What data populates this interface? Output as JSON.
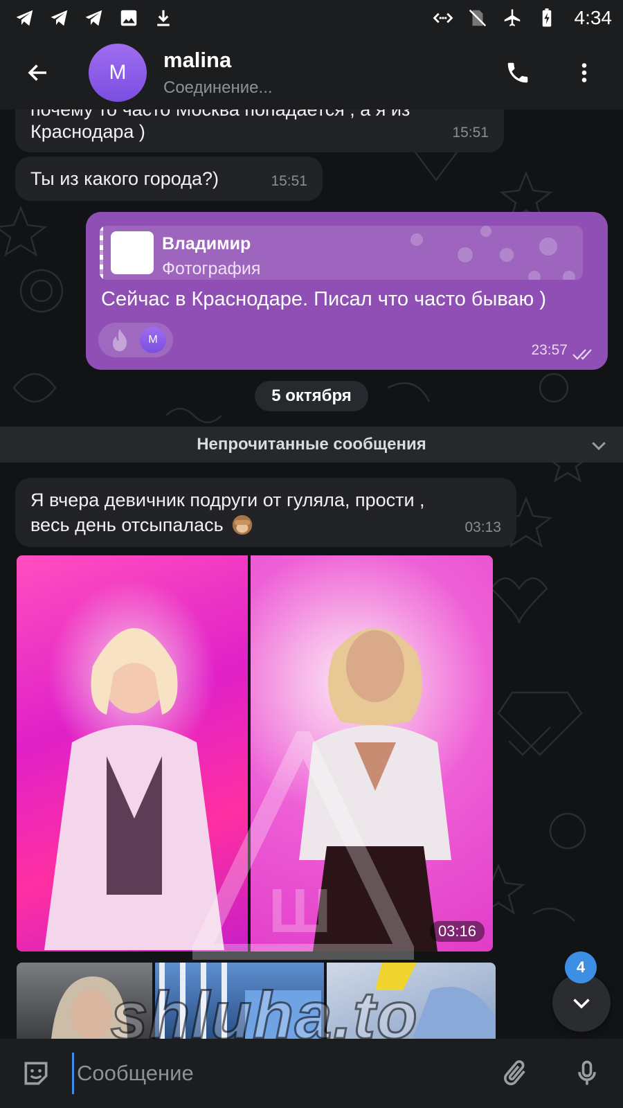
{
  "status_bar": {
    "time": "4:34",
    "icons_left": [
      "telegram-icon",
      "telegram-icon",
      "telegram-icon",
      "image-icon",
      "download-icon"
    ],
    "icons_right": [
      "network-code-icon",
      "no-sim-icon",
      "airplane-icon",
      "battery-charging-icon"
    ]
  },
  "header": {
    "avatar_letter": "M",
    "name": "malina",
    "status": "Соединение..."
  },
  "messages": [
    {
      "id": "m1",
      "direction": "in",
      "text_partial": "почему то часто Москва попадается , а я из",
      "text": "Краснодара )",
      "time": "15:51"
    },
    {
      "id": "m2",
      "direction": "in",
      "text": "Ты из какого города?)",
      "time": "15:51"
    },
    {
      "id": "m3",
      "direction": "out",
      "reply": {
        "name": "Владимир",
        "subtitle": "Фотография"
      },
      "text": "Сейчас в Краснодаре. Писал что часто бываю )",
      "reaction": {
        "emoji": "fire",
        "avatar_letter": "M"
      },
      "time": "23:57",
      "read": true
    }
  ],
  "date_separator": "5 октября",
  "unread_separator": "Непрочитанные сообщения",
  "messages_after": [
    {
      "id": "m4",
      "direction": "in",
      "line1": "Я вчера девичник подруги от гуляла, прости ,",
      "line2": "весь день отсыпалась",
      "emoji": "see-no-evil-monkey",
      "time": "03:13"
    },
    {
      "id": "m5",
      "direction": "in",
      "type": "photo-album",
      "photos": 2,
      "time": "03:16"
    },
    {
      "id": "m6",
      "direction": "in",
      "type": "photo-album",
      "photos": 3
    }
  ],
  "watermark": "shluha.to",
  "scroll_down": {
    "unread_count": "4"
  },
  "composer": {
    "placeholder": "Сообщение"
  },
  "colors": {
    "outgoing_bubble": "#8f4fb5",
    "incoming_bubble": "#212326",
    "accent": "#3d8fe6",
    "background": "#111315"
  }
}
